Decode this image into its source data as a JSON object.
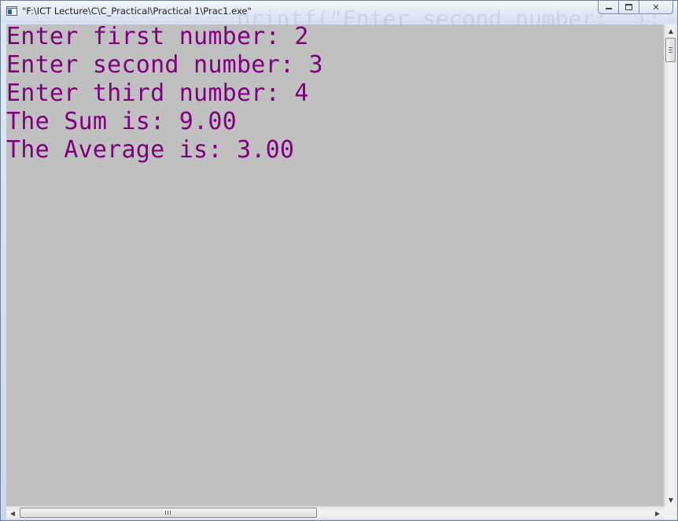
{
  "window": {
    "title": "\"F:\\ICT Lecture\\C\\C_Practical\\Practical 1\\Prac1.exe\"",
    "ghost_text": "printf(\"Enter second number: \");"
  },
  "controls": {
    "minimize_icon": "minimize-icon",
    "maximize_icon": "maximize-icon",
    "close_icon": "close-icon",
    "close_glyph": "✕"
  },
  "console": {
    "background_color": "#c0c0c0",
    "text_color": "#800080",
    "lines": [
      "Enter first number: 2",
      "Enter second number: 3",
      "Enter third number: 4",
      "The Sum is: 9.00",
      "The Average is: 3.00"
    ]
  },
  "scrollbars": {
    "up_arrow": "▲",
    "down_arrow": "▼",
    "left_arrow": "◀",
    "right_arrow": "▶"
  }
}
